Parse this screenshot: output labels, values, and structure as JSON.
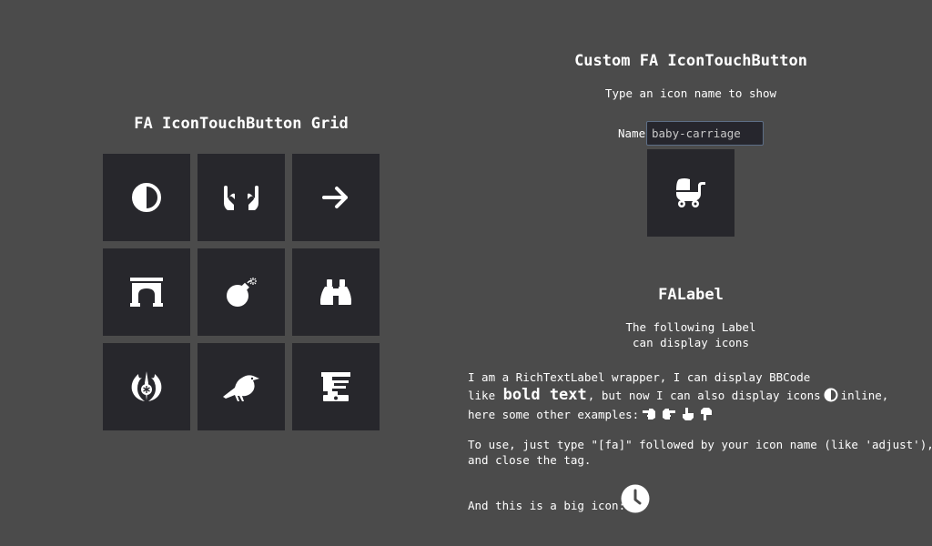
{
  "left_panel": {
    "title": "FA IconTouchButton Grid",
    "grid_icons": [
      "adjust-icon",
      "hands-icon",
      "arrow-right-icon",
      "archway-icon",
      "bomb-icon",
      "binoculars-icon",
      "jedi-order-icon",
      "crow-icon",
      "dumpster-icon"
    ]
  },
  "custom_button": {
    "title": "Custom FA IconTouchButton",
    "subtitle": "Type an icon name to show",
    "name_label": "Name",
    "name_value": "baby-carriage",
    "icon": "baby-carriage-icon"
  },
  "falabel": {
    "title": "FALabel",
    "description_line1": "The following Label",
    "description_line2": "can display icons",
    "rich_text": {
      "line1": "I am a RichTextLabel wrapper, I can display BBCode",
      "line2_prefix": "like",
      "line2_bold": "bold text",
      "line2_middle": ", but now I can also display icons",
      "line2_suffix": "inline,",
      "line2_icon": "adjust-icon",
      "line3_prefix": "here some other examples:",
      "line3_icons": [
        "hand-point-left-icon",
        "hand-point-right-icon",
        "hand-point-up-icon",
        "hand-point-down-icon"
      ],
      "line4": "To use, just type \"[fa]\" followed by your icon name (like 'adjust'),",
      "line5": "and close the tag.",
      "big_icon_prefix": "And this is a big icon:",
      "big_icon": "clock-icon"
    }
  },
  "colors": {
    "background": "#4b4b4b",
    "button_bg": "#27272c",
    "input_border": "#5d6e86",
    "text": "#ffffff"
  }
}
